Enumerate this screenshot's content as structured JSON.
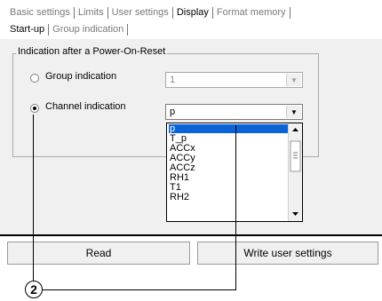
{
  "tabs_primary": [
    "Basic settings",
    "Limits",
    "User settings",
    "Display",
    "Format memory"
  ],
  "tabs_primary_active": "Display",
  "tabs_secondary": [
    "Start-up",
    "Group indication"
  ],
  "tabs_secondary_active": "Start-up",
  "group": {
    "title": "Indication after a Power-On-Reset",
    "group_label": "Group indication",
    "group_value": "1",
    "channel_label": "Channel indication",
    "channel_value": "p",
    "selected_option": "Channel indication"
  },
  "dropdown": {
    "options": [
      "p",
      "T_p",
      "ACCx",
      "ACCy",
      "ACCz",
      "RH1",
      "T1",
      "RH2"
    ],
    "selected": "p"
  },
  "buttons": {
    "read": "Read",
    "write": "Write user settings"
  },
  "callout": "2",
  "icons": {
    "dropdown_arrow": "chevron-down-icon",
    "scroll_up": "scroll-up-icon",
    "scroll_down": "scroll-down-icon"
  }
}
